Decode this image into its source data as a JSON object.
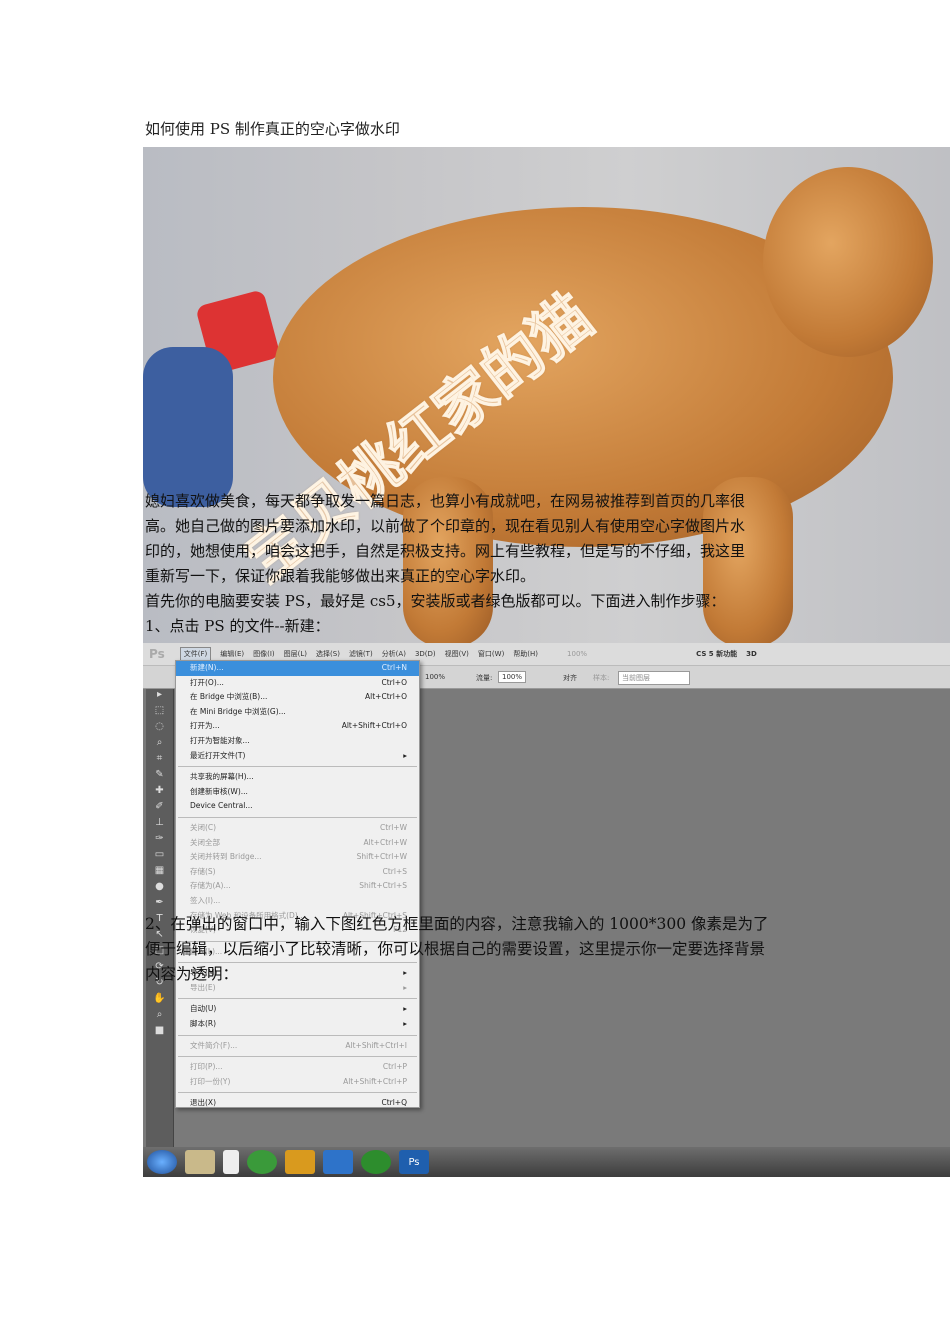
{
  "doc": {
    "title": "如何使用 PS 制作真正的空心字做水印",
    "watermark": "宝贝桃红家的猫",
    "para1": [
      "媳妇喜欢做美食，每天都争取发一篇日志，也算小有成就吧，在网易被推荐到首页的几率很",
      "高。她自己做的图片要添加水印，以前做了个印章的，现在看见别人有使用空心字做图片水",
      "印的，她想使用，咱会这把手，自然是积极支持。网上有些教程，但是写的不仔细，我这里",
      "重新写一下，保证你跟着我能够做出来真正的空心字水印。",
      "首先你的电脑要安装 PS，最好是 cs5，安装版或者绿色版都可以。下面进入制作步骤：",
      "1、点击 PS 的文件--新建："
    ],
    "para2": [
      "2、在弹出的窗口中，输入下图红色方框里面的内容，注意我输入的  1000*300  像素是为了",
      "便于编辑，以后缩小了比较清晰，你可以根据自己的需要设置，这里提示你一定要选择背景",
      "内容为透明："
    ]
  },
  "ps": {
    "logo": "Ps",
    "menus": [
      "文件(F)",
      "编辑(E)",
      "图像(I)",
      "图层(L)",
      "选择(S)",
      "滤镜(T)",
      "分析(A)",
      "3D(D)",
      "视图(V)",
      "窗口(W)",
      "帮助(H)"
    ],
    "zoom": "100%",
    "workspace": "CS 5 新功能",
    "workspace2": "3D",
    "options": {
      "flow_label": "流量:",
      "flow": "100%",
      "opacity": "100%",
      "align": "对齐",
      "sample_label": "样本:",
      "sample": "当前图层"
    },
    "file_menu": [
      {
        "label": "新建(N)...",
        "shortcut": "Ctrl+N",
        "state": "selected"
      },
      {
        "label": "打开(O)...",
        "shortcut": "Ctrl+O"
      },
      {
        "label": "在 Bridge 中浏览(B)...",
        "shortcut": "Alt+Ctrl+O"
      },
      {
        "label": "在 Mini Bridge 中浏览(G)...",
        "shortcut": ""
      },
      {
        "label": "打开为...",
        "shortcut": "Alt+Shift+Ctrl+O"
      },
      {
        "label": "打开为智能对象...",
        "shortcut": ""
      },
      {
        "label": "最近打开文件(T)",
        "shortcut": "▸",
        "sep_after": true
      },
      {
        "label": "共享我的屏幕(H)...",
        "shortcut": ""
      },
      {
        "label": "创建新审核(W)...",
        "shortcut": ""
      },
      {
        "label": "Device Central...",
        "shortcut": "",
        "sep_after": true
      },
      {
        "label": "关闭(C)",
        "shortcut": "Ctrl+W",
        "state": "disabled"
      },
      {
        "label": "关闭全部",
        "shortcut": "Alt+Ctrl+W",
        "state": "disabled"
      },
      {
        "label": "关闭并转到 Bridge...",
        "shortcut": "Shift+Ctrl+W",
        "state": "disabled"
      },
      {
        "label": "存储(S)",
        "shortcut": "Ctrl+S",
        "state": "disabled"
      },
      {
        "label": "存储为(A)...",
        "shortcut": "Shift+Ctrl+S",
        "state": "disabled"
      },
      {
        "label": "签入(I)...",
        "shortcut": "",
        "state": "disabled"
      },
      {
        "label": "存储为 Web 和设备所用格式(D)...",
        "shortcut": "Alt+Shift+Ctrl+S",
        "state": "disabled"
      },
      {
        "label": "恢复(V)",
        "shortcut": "F12",
        "state": "disabled",
        "sep_after": true
      },
      {
        "label": "置入(L)...",
        "shortcut": "",
        "state": "disabled",
        "sep_after": true
      },
      {
        "label": "导入(M)",
        "shortcut": "▸"
      },
      {
        "label": "导出(E)",
        "shortcut": "▸",
        "state": "disabled",
        "sep_after": true
      },
      {
        "label": "自动(U)",
        "shortcut": "▸"
      },
      {
        "label": "脚本(R)",
        "shortcut": "▸",
        "sep_after": true
      },
      {
        "label": "文件简介(F)...",
        "shortcut": "Alt+Shift+Ctrl+I",
        "state": "disabled",
        "sep_after": true
      },
      {
        "label": "打印(P)...",
        "shortcut": "Ctrl+P",
        "state": "disabled"
      },
      {
        "label": "打印一份(Y)",
        "shortcut": "Alt+Shift+Ctrl+P",
        "state": "disabled",
        "sep_after": true
      },
      {
        "label": "退出(X)",
        "shortcut": "Ctrl+Q"
      }
    ],
    "taskbar_ps": "Ps"
  }
}
